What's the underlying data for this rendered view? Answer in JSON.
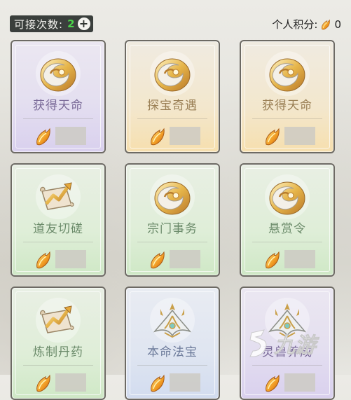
{
  "header": {
    "counter_label": "可接次数:",
    "counter_value": "2",
    "plus_label": "+",
    "points_label": "个人积分:",
    "points_value": "0",
    "points_icon": "feather-coin-icon"
  },
  "cards": [
    {
      "title": "获得天命",
      "icon": "swirl-orb-icon",
      "theme": "purple"
    },
    {
      "title": "探宝奇遇",
      "icon": "swirl-orb-icon",
      "theme": "yellow"
    },
    {
      "title": "获得天命",
      "icon": "swirl-orb-icon",
      "theme": "yellow"
    },
    {
      "title": "道友切磋",
      "icon": "scroll-arrow-icon",
      "theme": "green"
    },
    {
      "title": "宗门事务",
      "icon": "swirl-orb-icon",
      "theme": "green"
    },
    {
      "title": "悬赏令",
      "icon": "swirl-orb-icon",
      "theme": "green"
    },
    {
      "title": "炼制丹药",
      "icon": "scroll-arrow-icon",
      "theme": "green"
    },
    {
      "title": "本命法宝",
      "icon": "artifact-crown-icon",
      "theme": "blue"
    },
    {
      "title": "灵兽养成",
      "icon": "artifact-crown-icon",
      "theme": "purple"
    }
  ],
  "watermark": {
    "text": "九游",
    "icon": "jiuyou-logo-icon"
  }
}
